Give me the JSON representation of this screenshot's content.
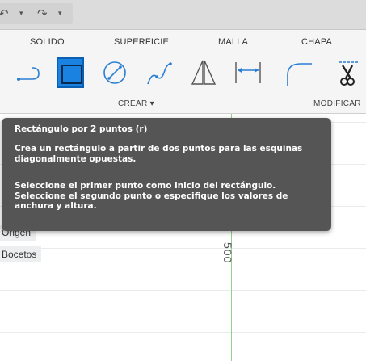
{
  "quick_access": {
    "undo_icon": "undo-icon",
    "redo_icon": "redo-icon",
    "caret": "▾"
  },
  "ribbon": {
    "tabs": [
      "SOLIDO",
      "SUPERFICIE",
      "MALLA",
      "CHAPA"
    ],
    "tools": [
      {
        "name": "line-tool",
        "icon": "line-icon"
      },
      {
        "name": "rectangle-2-point-tool",
        "icon": "rectangle-icon",
        "active": true
      },
      {
        "name": "circle-tool",
        "icon": "circle-icon"
      },
      {
        "name": "spline-tool",
        "icon": "spline-icon"
      },
      {
        "name": "mirror-tool",
        "icon": "mirror-icon"
      },
      {
        "name": "dimension-tool",
        "icon": "dimension-icon"
      },
      {
        "name": "fillet-tool",
        "icon": "fillet-icon"
      },
      {
        "name": "trim-tool",
        "icon": "scissors-icon"
      }
    ],
    "groups": {
      "create": "CREAR ▾",
      "modify": "MODIFICAR"
    }
  },
  "canvas": {
    "axis_label": "500",
    "browser_items": [
      "Origen",
      "Bocetos"
    ]
  },
  "tooltip": {
    "title": "Rectángulo por 2 puntos (r)",
    "description": "Crea un rectángulo a partir de dos puntos para las esquinas diagonalmente opuestas.",
    "instruction_1": "Seleccione el primer punto como inicio del rectángulo.",
    "instruction_2": "Seleccione el segundo punto o especifique los valores de anchura y altura."
  },
  "colors": {
    "accent": "#1a82e0",
    "tooltip_bg": "#555555",
    "axis_green": "#8fd38a"
  }
}
